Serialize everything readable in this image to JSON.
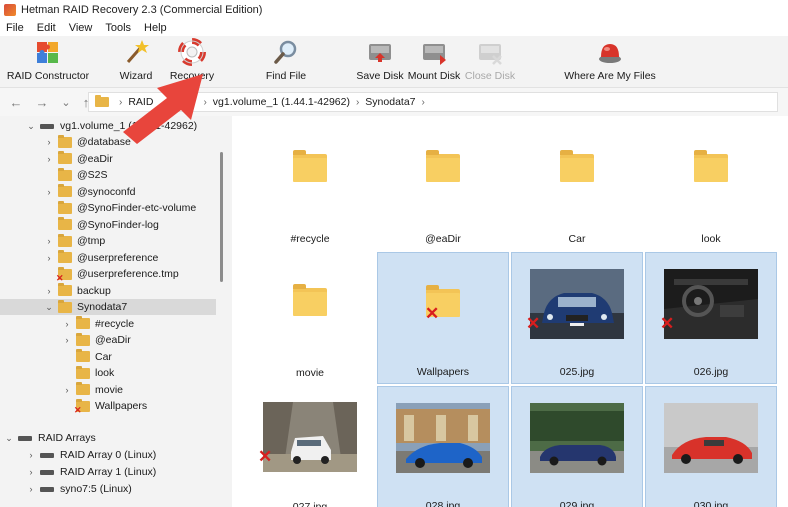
{
  "window": {
    "title": "Hetman RAID Recovery 2.3 (Commercial Edition)"
  },
  "menu": [
    "File",
    "Edit",
    "View",
    "Tools",
    "Help"
  ],
  "toolbar": {
    "raid_constructor": "RAID Constructor",
    "wizard": "Wizard",
    "recovery": "Recovery",
    "find_file": "Find File",
    "save_disk": "Save Disk",
    "mount_disk": "Mount Disk",
    "close_disk": "Close Disk",
    "where_files": "Where Are My Files"
  },
  "address": {
    "crumb1": "RAID",
    "crumb2": "vg1.volume_1 (1.44.1-42962)",
    "crumb3": "Synodata7"
  },
  "tree": {
    "root": "vg1.volume_1 (1.44.1-42962)",
    "items": [
      {
        "label": "@database",
        "chev": "›",
        "deleted": false
      },
      {
        "label": "@eaDir",
        "chev": "›",
        "deleted": false
      },
      {
        "label": "@S2S",
        "chev": "",
        "deleted": false
      },
      {
        "label": "@synoconfd",
        "chev": "›",
        "deleted": false
      },
      {
        "label": "@SynoFinder-etc-volume",
        "chev": "",
        "deleted": false
      },
      {
        "label": "@SynoFinder-log",
        "chev": "",
        "deleted": false
      },
      {
        "label": "@tmp",
        "chev": "›",
        "deleted": false
      },
      {
        "label": "@userpreference",
        "chev": "›",
        "deleted": false
      },
      {
        "label": "@userpreference.tmp",
        "chev": "",
        "deleted": true
      },
      {
        "label": "backup",
        "chev": "›",
        "deleted": false
      },
      {
        "label": "Synodata7",
        "chev": "⌄",
        "deleted": false
      }
    ],
    "sub_items": [
      {
        "label": "#recycle",
        "chev": "›",
        "deleted": false
      },
      {
        "label": "@eaDir",
        "chev": "›",
        "deleted": false
      },
      {
        "label": "Car",
        "chev": "",
        "deleted": false
      },
      {
        "label": "look",
        "chev": "",
        "deleted": false
      },
      {
        "label": "movie",
        "chev": "›",
        "deleted": false
      },
      {
        "label": "Wallpapers",
        "chev": "",
        "deleted": true
      }
    ],
    "raid_arrays": "RAID Arrays",
    "arrays": [
      "RAID Array 0 (Linux)",
      "RAID Array 1 (Linux)",
      "syno7:5 (Linux)"
    ]
  },
  "grid": {
    "items": [
      {
        "name": "#recycle",
        "kind": "folder",
        "deleted": false,
        "selected": false
      },
      {
        "name": "@eaDir",
        "kind": "folder",
        "deleted": false,
        "selected": false
      },
      {
        "name": "Car",
        "kind": "folder",
        "deleted": false,
        "selected": false
      },
      {
        "name": "look",
        "kind": "folder",
        "deleted": false,
        "selected": false
      },
      {
        "name": "movie",
        "kind": "folder",
        "deleted": false,
        "selected": false
      },
      {
        "name": "Wallpapers",
        "kind": "folder",
        "deleted": true,
        "selected": true
      },
      {
        "name": "025.jpg",
        "kind": "image-car-front",
        "deleted": true,
        "selected": true
      },
      {
        "name": "026.jpg",
        "kind": "image-car-interior",
        "deleted": true,
        "selected": true
      },
      {
        "name": "027.jpg",
        "kind": "image-suv",
        "deleted": true,
        "selected": false
      },
      {
        "name": "028.jpg",
        "kind": "image-blue-coupe",
        "deleted": false,
        "selected": true
      },
      {
        "name": "029.jpg",
        "kind": "image-convertible",
        "deleted": false,
        "selected": true
      },
      {
        "name": "030.jpg",
        "kind": "image-red-coupe",
        "deleted": false,
        "selected": true
      }
    ]
  },
  "colors": {
    "selection": "#cfe1f3",
    "folder": "#f3c456",
    "deleted_mark": "#d81e1e",
    "arrow": "#e8453c"
  }
}
